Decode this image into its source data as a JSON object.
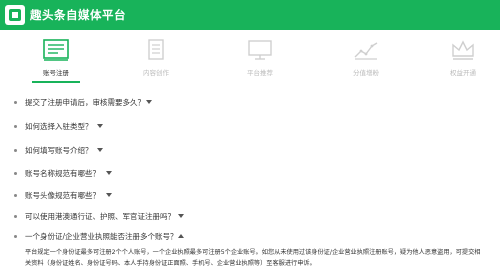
{
  "header": {
    "brand": "趣头条自媒体平台"
  },
  "steps": [
    {
      "label": "账号注册",
      "icon": "register-form-icon",
      "active": true
    },
    {
      "label": "内容创作",
      "icon": "document-icon",
      "active": false
    },
    {
      "label": "平台推荐",
      "icon": "monitor-icon",
      "active": false
    },
    {
      "label": "分值增粉",
      "icon": "growth-chart-icon",
      "active": false
    },
    {
      "label": "权益开通",
      "icon": "crown-icon",
      "active": false
    }
  ],
  "faq": [
    {
      "question": "提交了注册申请后，审核需要多久？",
      "expanded": false
    },
    {
      "question": "如何选择入驻类型？",
      "expanded": false
    },
    {
      "question": "如何填写账号介绍？",
      "expanded": false
    },
    {
      "question": "账号名称规范有哪些？",
      "expanded": false
    },
    {
      "question": "账号头像规范有哪些？",
      "expanded": false
    },
    {
      "question": "可以使用港澳通行证、护照、军官证注册吗？",
      "expanded": false
    },
    {
      "question": "一个身份证/企业营业执照能否注册多个账号？",
      "expanded": true
    }
  ],
  "answer": {
    "line1": "平台规定一个身份证最多可注册2个个人账号，一个企业执照最多可注册5个企业账号。如您从未使用过该身份证/企业营业执照注册账号，疑为他人恶意盗用，可提交相",
    "line2": "关资料（身份证姓名、身份证号码、本人手持身份证正面照、手机号、企业营业执照等）至客服进行申诉。"
  },
  "colors": {
    "brand": "#18b35a"
  }
}
